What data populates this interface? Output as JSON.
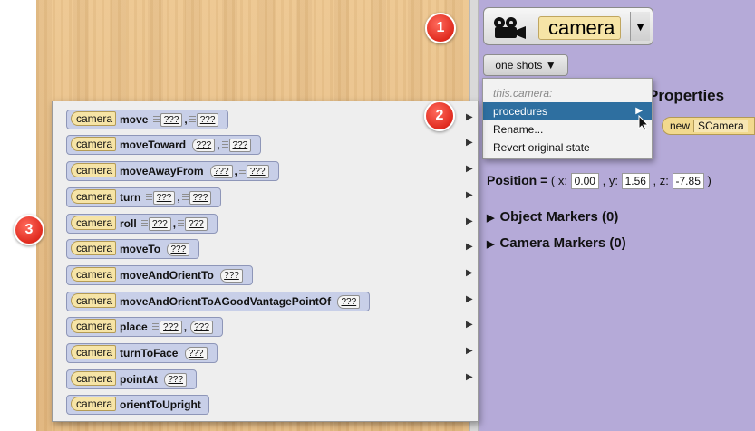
{
  "camera_selector": {
    "label": "camera",
    "dropdown_glyph": "▼",
    "icon": "movie-camera-icon"
  },
  "one_shots": {
    "label": "one shots ▼"
  },
  "badges": [
    "1",
    "2",
    "3"
  ],
  "context_menu": {
    "header": "this.camera:",
    "items": [
      {
        "label": "procedures",
        "has_submenu": true,
        "active": true
      },
      {
        "label": "Rename...",
        "has_submenu": false,
        "active": false
      },
      {
        "label": "Revert original state",
        "has_submenu": false,
        "active": false
      }
    ],
    "active_color": "#2e6fa0"
  },
  "properties": {
    "title": "Properties",
    "new_label": "new",
    "type_label": "SCamera",
    "position_label": "Position =",
    "open": "( x:",
    "x": "0.00",
    "y_label": ", y:",
    "y": "1.56",
    "z_label": ", z:",
    "z": "-7.85",
    "close": ")"
  },
  "tree": [
    {
      "label": "Object Markers (0)"
    },
    {
      "label": "Camera Markers (0)"
    }
  ],
  "procedures_menu": {
    "target_label": "camera",
    "placeholder": "???",
    "comma": ",",
    "items": [
      {
        "name": "move"
      },
      {
        "name": "moveToward"
      },
      {
        "name": "moveAwayFrom"
      },
      {
        "name": "turn"
      },
      {
        "name": "roll"
      },
      {
        "name": "moveTo"
      },
      {
        "name": "moveAndOrientTo"
      },
      {
        "name": "moveAndOrientToAGoodVantagePointOf"
      },
      {
        "name": "place"
      },
      {
        "name": "turnToFace"
      },
      {
        "name": "pointAt"
      },
      {
        "name": "orientToUpright"
      }
    ]
  },
  "colors": {
    "panel_bg": "#b5aad8",
    "procedure_block": "#c8cfe8",
    "chip_yellow": "#f6e4a6",
    "badge_red": "#e02b1f"
  }
}
